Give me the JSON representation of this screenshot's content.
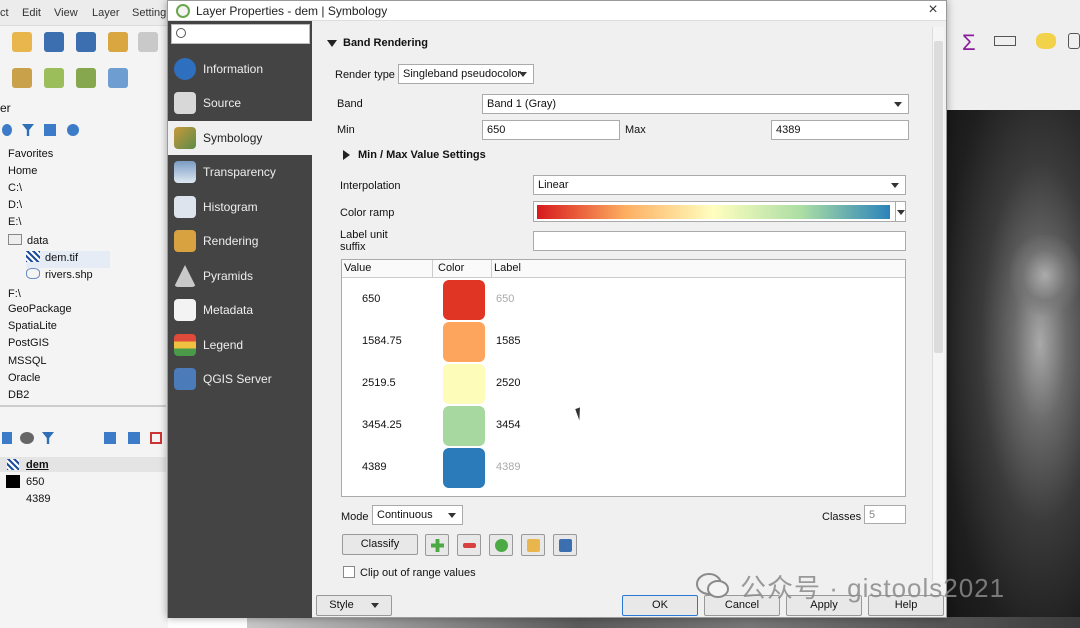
{
  "menubar": [
    "ct",
    "Edit",
    "View",
    "Layer",
    "Setting"
  ],
  "browser": {
    "panel_label": "er",
    "items": [
      {
        "label": "Favorites",
        "icon": "star-icon"
      },
      {
        "label": "Home",
        "icon": "folder-icon"
      },
      {
        "label": "C:\\",
        "icon": "drive-icon"
      },
      {
        "label": "D:\\",
        "icon": "drive-icon"
      },
      {
        "label": "E:\\",
        "icon": "drive-icon"
      },
      {
        "label": "data",
        "icon": "folder-icon"
      },
      {
        "label": "dem.tif",
        "icon": "raster-icon"
      },
      {
        "label": "rivers.shp",
        "icon": "vector-icon"
      },
      {
        "label": "F:\\",
        "icon": "drive-icon"
      },
      {
        "label": "GeoPackage",
        "icon": "geopackage-icon"
      },
      {
        "label": "SpatiaLite",
        "icon": "spatialite-icon"
      },
      {
        "label": "PostGIS",
        "icon": "postgis-icon"
      },
      {
        "label": "MSSQL",
        "icon": "mssql-icon"
      },
      {
        "label": "Oracle",
        "icon": "oracle-icon"
      },
      {
        "label": "DB2",
        "icon": "db2-icon"
      }
    ]
  },
  "layers": {
    "layer_name": "dem",
    "min_value": "650",
    "max_value": "4389"
  },
  "dialog": {
    "title": "Layer Properties - dem | Symbology",
    "close": "×",
    "search_placeholder": "",
    "nav": [
      {
        "label": "Information",
        "icon": "information-icon"
      },
      {
        "label": "Source",
        "icon": "source-icon"
      },
      {
        "label": "Symbology",
        "icon": "symbology-icon",
        "selected": true
      },
      {
        "label": "Transparency",
        "icon": "transparency-icon"
      },
      {
        "label": "Histogram",
        "icon": "histogram-icon"
      },
      {
        "label": "Rendering",
        "icon": "rendering-icon"
      },
      {
        "label": "Pyramids",
        "icon": "pyramids-icon"
      },
      {
        "label": "Metadata",
        "icon": "metadata-icon"
      },
      {
        "label": "Legend",
        "icon": "legend-icon"
      },
      {
        "label": "QGIS Server",
        "icon": "qgis-server-icon"
      }
    ],
    "section_title": "Band Rendering",
    "render_type_label": "Render type",
    "render_type": "Singleband pseudocolor",
    "band_label": "Band",
    "band": "Band 1 (Gray)",
    "min_label": "Min",
    "min": "650",
    "max_label": "Max",
    "max": "4389",
    "minmax_settings": "Min / Max Value Settings",
    "interpolation_label": "Interpolation",
    "interpolation": "Linear",
    "color_ramp_label": "Color ramp",
    "label_unit_suffix_label_1": "Label unit",
    "label_unit_suffix_label_2": "suffix",
    "label_unit_suffix": "",
    "table": {
      "headers": [
        "Value",
        "Color",
        "Label"
      ],
      "rows": [
        {
          "value": "650",
          "color": "#e03424",
          "label": "650",
          "label_dim": true
        },
        {
          "value": "1584.75",
          "color": "#fda55c",
          "label": "1585",
          "label_dim": false
        },
        {
          "value": "2519.5",
          "color": "#fefcb9",
          "label": "2520",
          "label_dim": false
        },
        {
          "value": "3454.25",
          "color": "#a6d8a0",
          "label": "3454",
          "label_dim": false
        },
        {
          "value": "4389",
          "color": "#2b7bba",
          "label": "4389",
          "label_dim": true
        }
      ]
    },
    "mode_label": "Mode",
    "mode": "Continuous",
    "classes_label": "Classes",
    "classes": "5",
    "classify_label": "Classify",
    "clip_label": "Clip out of range values",
    "style_label": "Style",
    "ok_label": "OK",
    "cancel_label": "Cancel",
    "apply_label": "Apply",
    "help_label": "Help"
  },
  "watermark": "公众号 · gistools2021",
  "colors": {
    "sidebar": "#444444",
    "accent": "#2b78d6",
    "ramp": [
      "#d7191c",
      "#fdae61",
      "#ffffbf",
      "#abdda4",
      "#2b83ba"
    ]
  }
}
